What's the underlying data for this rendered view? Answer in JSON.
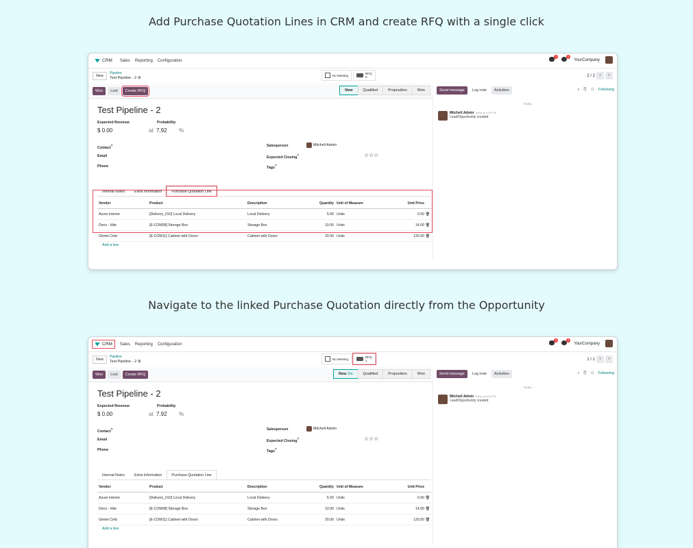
{
  "captions": {
    "top": "Add Purchase Quotation Lines in CRM and create RFQ with a single click",
    "bottom": "Navigate to the linked Purchase Quotation directly from the Opportunity"
  },
  "shots": [
    {
      "app": "CRM",
      "menu": [
        "Sales",
        "Reporting",
        "Configuration"
      ],
      "badges": {
        "messages": "3",
        "activities": "6"
      },
      "company": "YourCompany",
      "new_label": "New",
      "breadcrumb_parent": "Pipeline",
      "breadcrumb_current": "Test Pipeline - 2",
      "meeting_label": "No Meeting",
      "rfq_label": "RFQ",
      "rfq_count": "0",
      "pager": "2 / 2",
      "buttons": {
        "won": "Won",
        "lost": "Lost",
        "create_rfq": "Create RFQ"
      },
      "stages": [
        "New",
        "Qualified",
        "Proposition",
        "Won"
      ],
      "active_stage_extra": "",
      "title": "Test Pipeline - 2",
      "expected_revenue_label": "Expected Revenue",
      "expected_revenue": "$ 0.00",
      "at_label": "at",
      "probability_label": "Probability",
      "probability": "7.92",
      "percent": "%",
      "contact_label": "Contact",
      "email_label": "Email",
      "phone_label": "Phone",
      "salesperson_label": "Salesperson",
      "salesperson": "Mitchell Admin",
      "expected_closing_label": "Expected Closing",
      "tags_label": "Tags",
      "stars": "☆☆☆",
      "tabs": [
        "Internal Notes",
        "Extra Information",
        "Purchase Quotation Line"
      ],
      "columns": [
        "Vendor",
        "Product",
        "Description",
        "Quantity",
        "Unit of Measure",
        "Unit Price"
      ],
      "rows": [
        [
          "Azure Interior",
          "[Delivery_010] Local Delivery",
          "Local Delivery",
          "5.00",
          "Units",
          "0.00"
        ],
        [
          "Deco - Hite",
          "[E-COM08] Storage Box",
          "Storage Box",
          "10.00",
          "Units",
          "14.00"
        ],
        [
          "Gimini Cmb",
          "[E-COM11] Cabinet with Doors",
          "Cabinet with Doors",
          "20.00",
          "Units",
          "120.50"
        ]
      ],
      "add_line": "Add a line",
      "chatter": {
        "send": "Send message",
        "log": "Log note",
        "activities": "Activities",
        "following": "Following",
        "today": "Today",
        "author": "Mitchell Admin",
        "time": "Today at 3:55 PM",
        "text": "Lead/Opportunity created"
      }
    },
    {
      "app": "CRM",
      "menu": [
        "Sales",
        "Reporting",
        "Configuration"
      ],
      "badges": {
        "messages": "3",
        "activities": "6"
      },
      "company": "YourCompany",
      "new_label": "New",
      "breadcrumb_parent": "Pipeline",
      "breadcrumb_current": "Test Pipeline - 2",
      "meeting_label": "No Meeting",
      "rfq_label": "RFQ",
      "rfq_count": "1",
      "pager": "1 / 1",
      "buttons": {
        "won": "Won",
        "lost": "Lost",
        "create_rfq": "Create RFQ"
      },
      "stages": [
        "New",
        "Qualified",
        "Proposition",
        "Won"
      ],
      "active_stage_extra": "2m",
      "title": "Test Pipeline - 2",
      "expected_revenue_label": "Expected Revenue",
      "expected_revenue": "$ 0.00",
      "at_label": "at",
      "probability_label": "Probability",
      "probability": "7.92",
      "percent": "%",
      "contact_label": "Contact",
      "email_label": "Email",
      "phone_label": "Phone",
      "salesperson_label": "Salesperson",
      "salesperson": "Mitchell Admin",
      "expected_closing_label": "Expected Closing",
      "tags_label": "Tags",
      "stars": "☆☆☆",
      "tabs": [
        "Internal Notes",
        "Extra Information",
        "Purchase Quotation Line"
      ],
      "columns": [
        "Vendor",
        "Product",
        "Description",
        "Quantity",
        "Unit of Measure",
        "Unit Price"
      ],
      "rows": [
        [
          "Azure Interior",
          "[Delivery_010] Local Delivery",
          "Local Delivery",
          "5.00",
          "Units",
          "0.00"
        ],
        [
          "Deco - Hite",
          "[E-COM08] Storage Box",
          "Storage Box",
          "10.00",
          "Units",
          "14.00"
        ],
        [
          "Gimini Cmb",
          "[E-COM11] Cabinet with Doors",
          "Cabinet with Doors",
          "20.00",
          "Units",
          "120.50"
        ]
      ],
      "add_line": "Add a line",
      "chatter": {
        "send": "Send message",
        "log": "Log note",
        "activities": "Activities",
        "following": "Following",
        "today": "Today",
        "author": "Mitchell Admin",
        "time": "Today at 3:55 PM",
        "text": "Lead/Opportunity created"
      }
    }
  ]
}
